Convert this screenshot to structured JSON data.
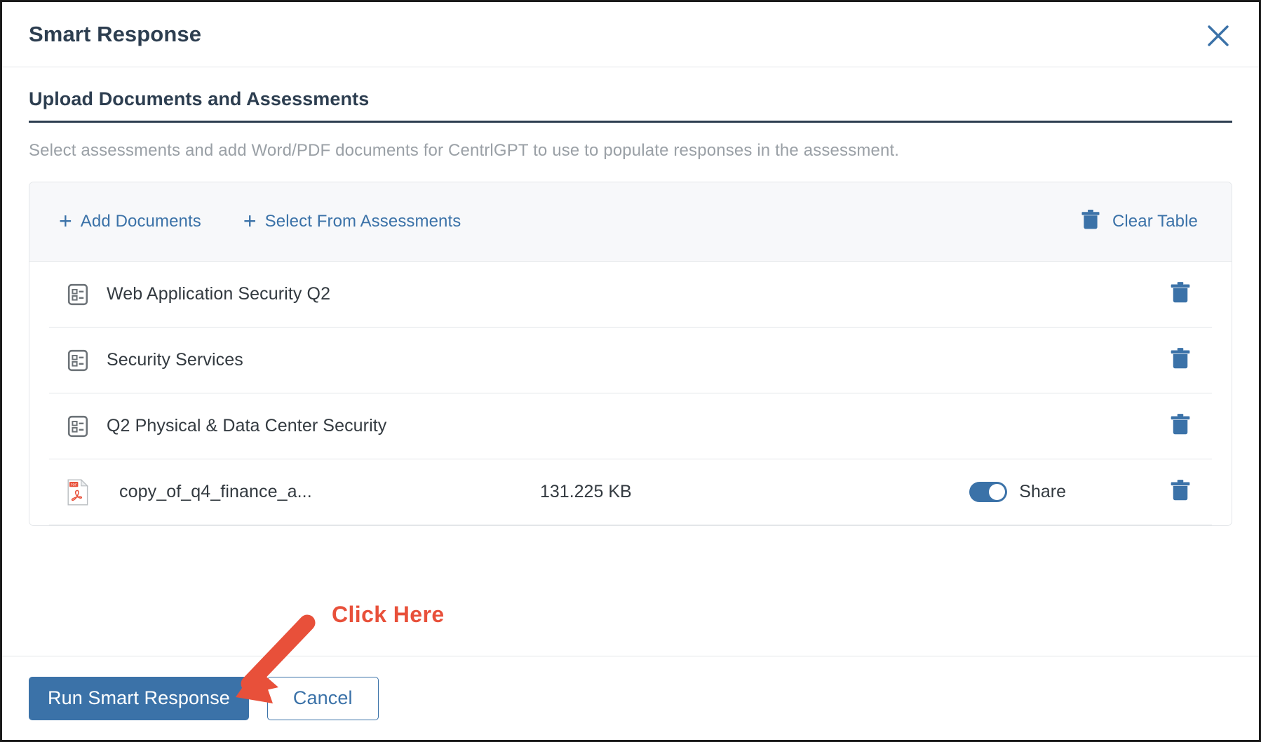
{
  "modal": {
    "title": "Smart Response",
    "close_icon": "close-icon"
  },
  "section": {
    "heading": "Upload Documents and Assessments",
    "description": "Select assessments and add Word/PDF documents for CentrlGPT to use to populate responses in the assessment."
  },
  "toolbar": {
    "add_documents_label": "Add Documents",
    "select_from_assessments_label": "Select From Assessments",
    "clear_table_label": "Clear Table",
    "plus_glyph": "+"
  },
  "table": {
    "rows": [
      {
        "type": "assessment",
        "icon": "assessment-icon",
        "name": "Web Application Security Q2",
        "size": "",
        "share_label": "",
        "share_on": false
      },
      {
        "type": "assessment",
        "icon": "assessment-icon",
        "name": "Security Services",
        "size": "",
        "share_label": "",
        "share_on": false
      },
      {
        "type": "assessment",
        "icon": "assessment-icon",
        "name": "Q2 Physical & Data Center Security",
        "size": "",
        "share_label": "",
        "share_on": false
      },
      {
        "type": "document",
        "icon": "pdf-file-icon",
        "name": "copy_of_q4_finance_a...",
        "size": "131.225 KB",
        "share_label": "Share",
        "share_on": true
      }
    ]
  },
  "footer": {
    "primary_label": "Run Smart Response",
    "secondary_label": "Cancel"
  },
  "annotation": {
    "label": "Click Here",
    "color": "#e8503a"
  },
  "colors": {
    "accent_blue": "#3b72a8",
    "heading_navy": "#2d3e50",
    "muted_text": "#9aa0a6",
    "row_text": "#333a40",
    "border": "#e3e6e9",
    "toolbar_bg": "#f7f8fa",
    "annotation_red": "#e8503a"
  }
}
